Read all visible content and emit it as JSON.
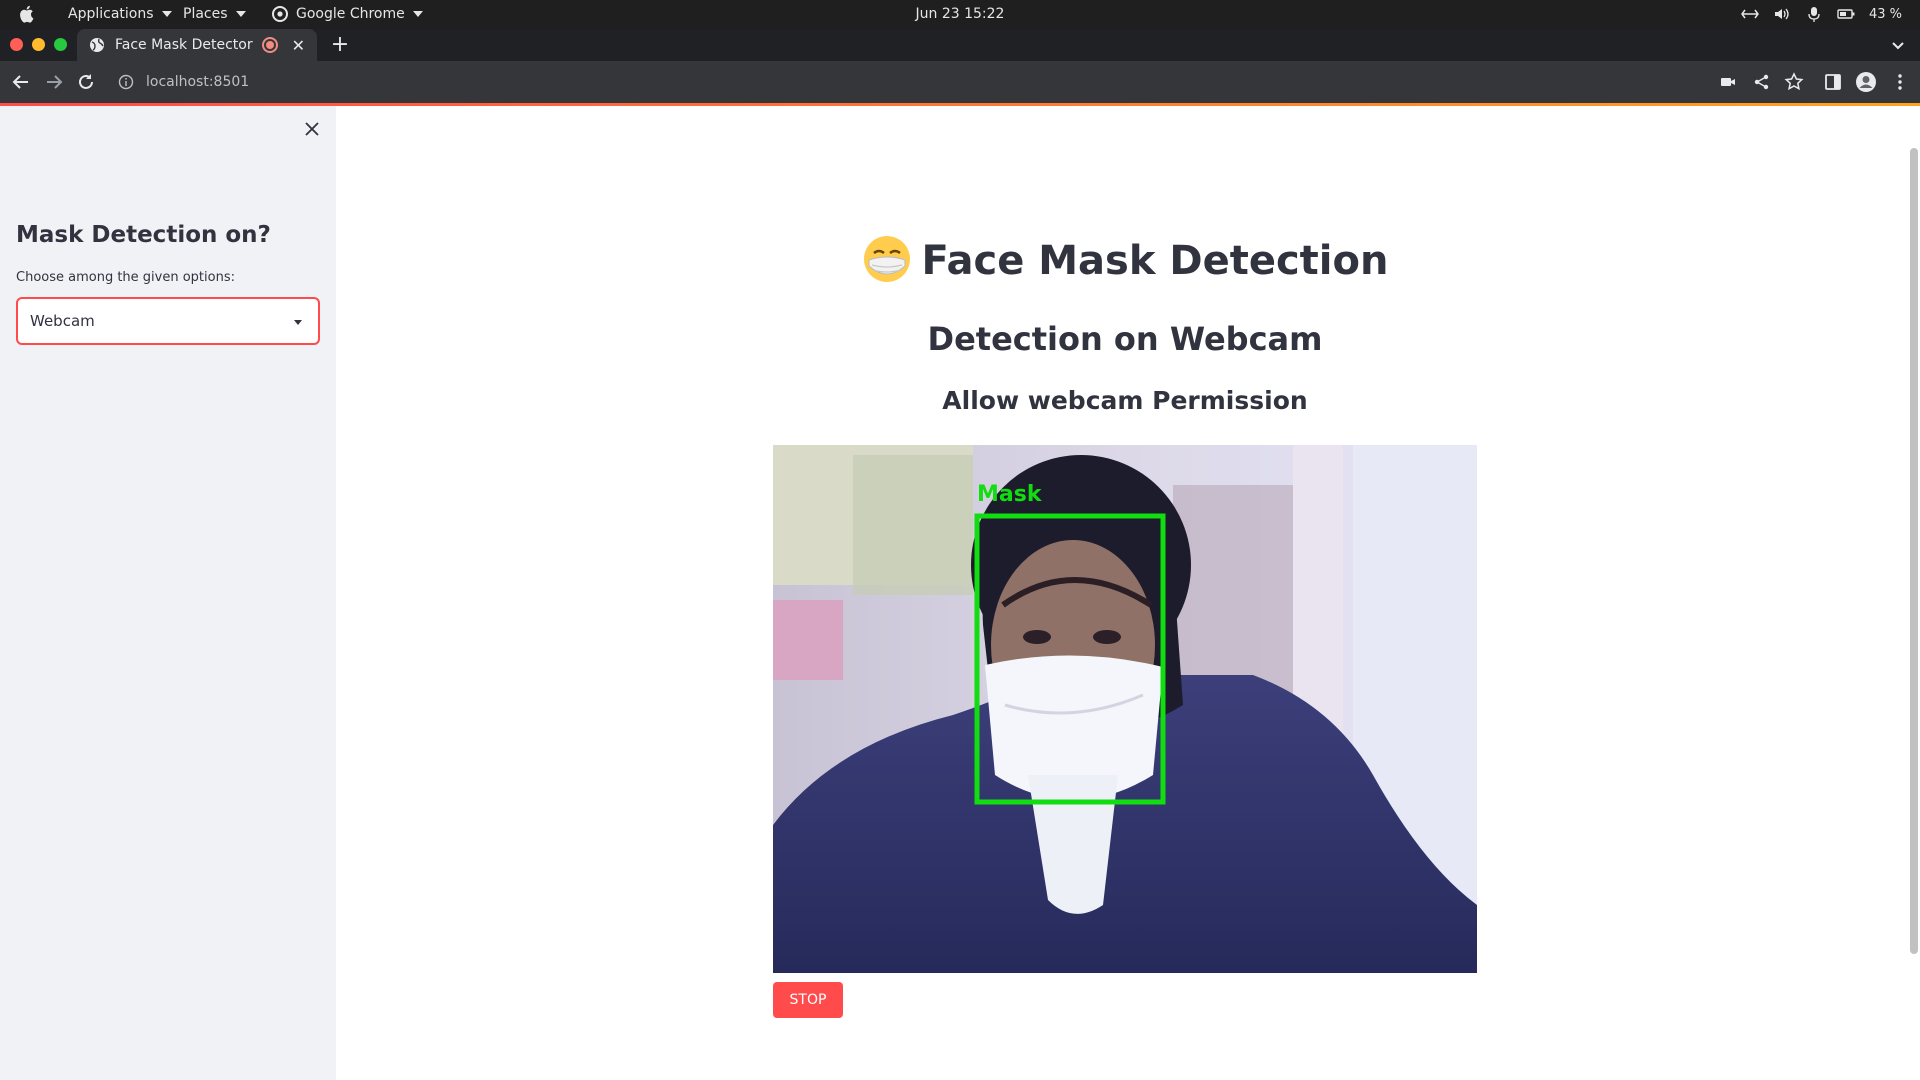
{
  "os_bar": {
    "applications": "Applications",
    "places": "Places",
    "app_name": "Google Chrome",
    "datetime": "Jun 23  15:22",
    "battery": "43 %"
  },
  "browser": {
    "tab_title": "Face Mask Detector",
    "url": "localhost:8501"
  },
  "sidebar": {
    "heading": "Mask Detection on?",
    "select_label": "Choose among the given options:",
    "selected_option": "Webcam"
  },
  "main": {
    "title": "Face Mask Detection",
    "subtitle": "Detection on Webcam",
    "instruction": "Allow webcam Permission",
    "detection_label": "Mask",
    "stop_label": "STOP"
  },
  "colors": {
    "accent": "#ff4b4b",
    "detection_box": "#11dd11",
    "text": "#31333f"
  }
}
